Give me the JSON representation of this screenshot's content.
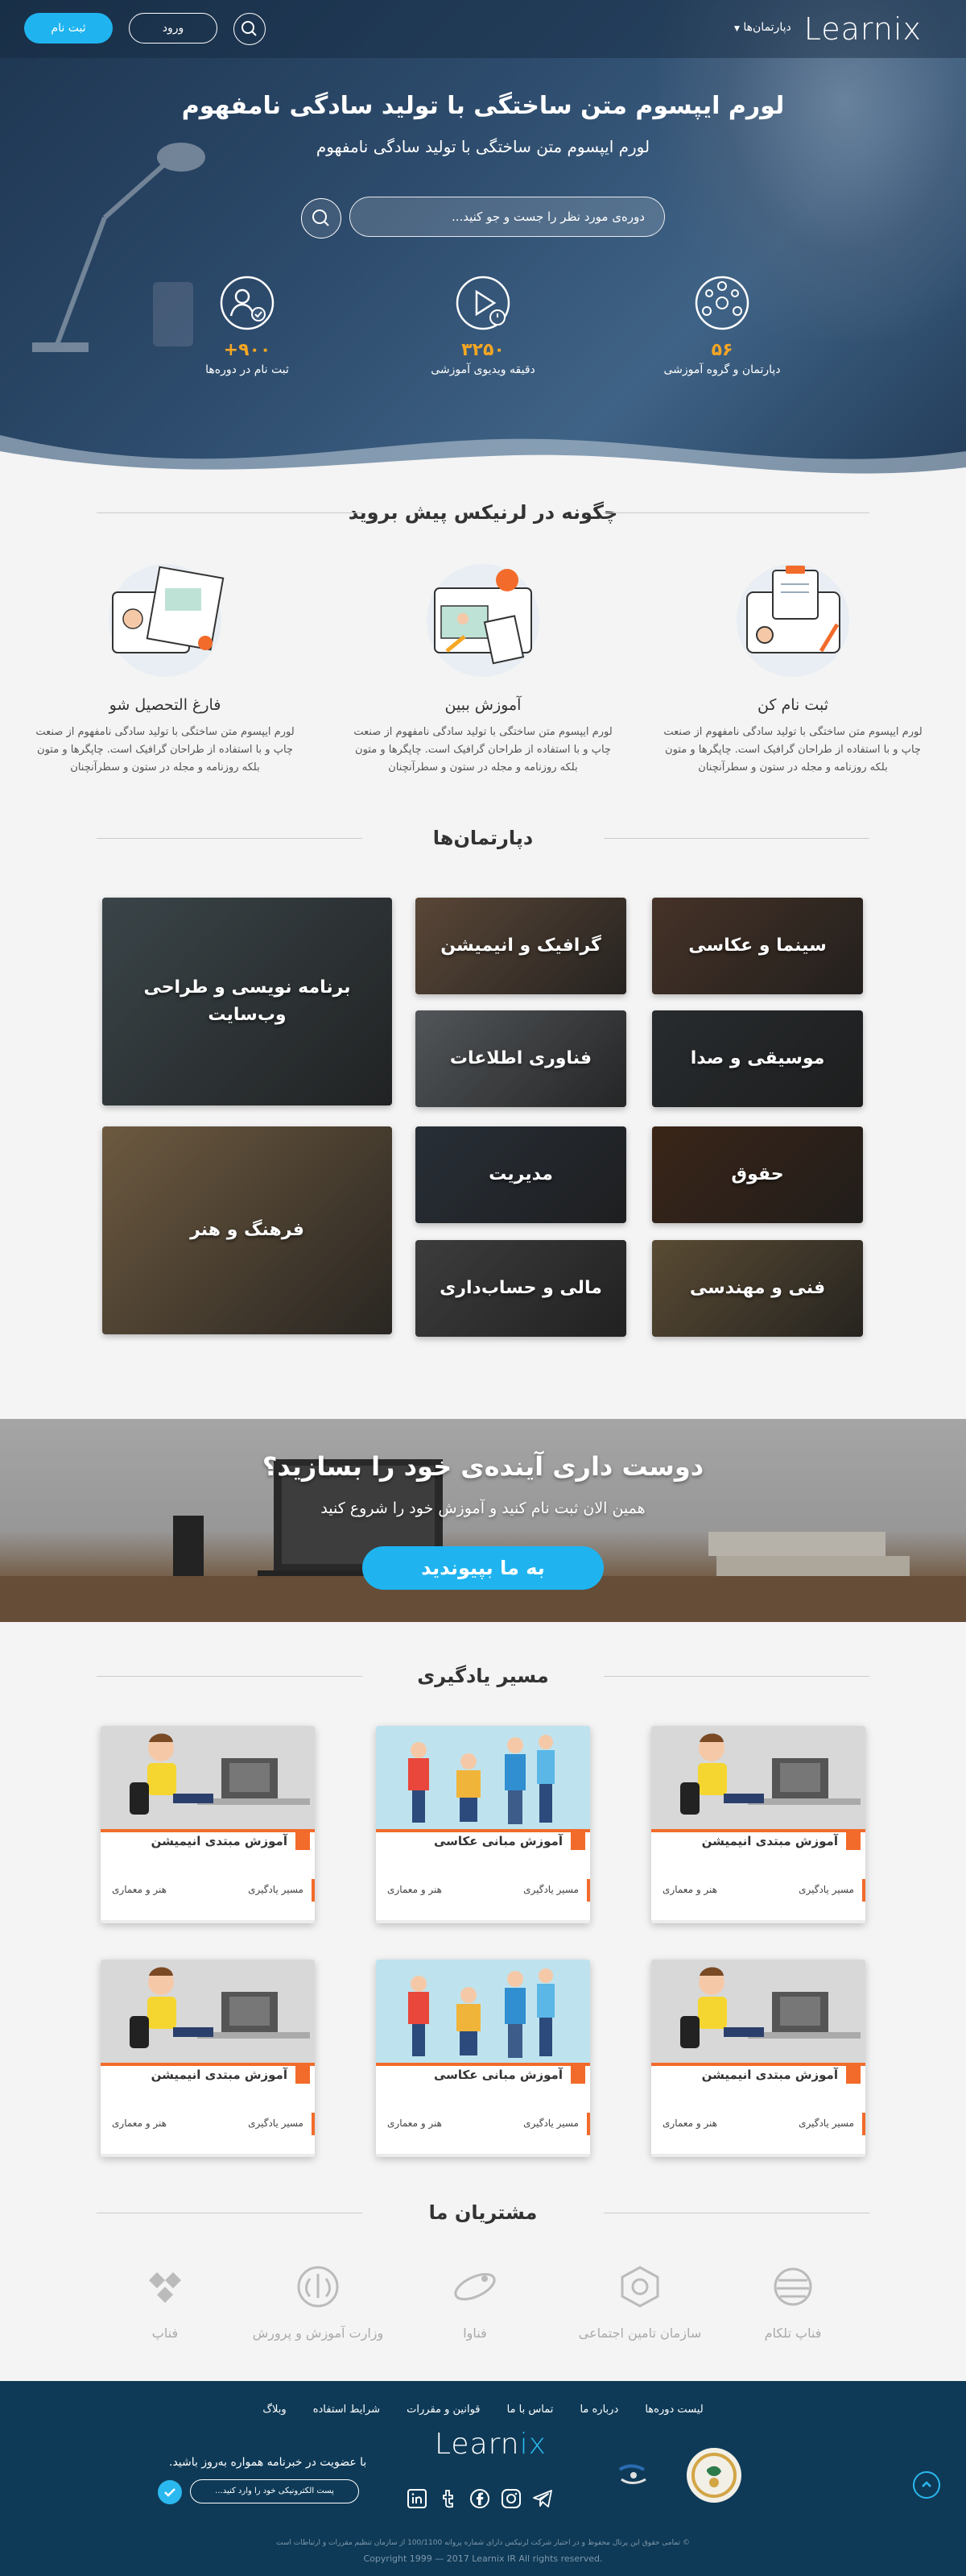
{
  "header": {
    "logo": "Learnix",
    "departments_menu": "دپارتمان‌ها",
    "login": "ورود",
    "signup": "ثبت نام"
  },
  "hero": {
    "title": "لورم ایپسوم متن ساختگی با تولید سادگی نامفهوم",
    "subtitle": "لورم ایپسوم متن ساختگی با تولید سادگی نامفهوم",
    "search_placeholder": "دوره‌ی مورد نظر را جست و جو کنید...",
    "stats": [
      {
        "icon": "group-network-icon",
        "number": "۵۶",
        "label": "دپارتمان و گروه آموزشی"
      },
      {
        "icon": "video-clock-icon",
        "number": "۳۲۵۰",
        "label": "دقیقه ویدیوی آموزشی"
      },
      {
        "icon": "users-check-icon",
        "number": "+۹۰۰",
        "label": "ثبت نام در دوره‌ها"
      }
    ]
  },
  "how": {
    "heading": "چگونه در لرنیکس پیش بروید",
    "steps": [
      {
        "title": "ثبت نام کن",
        "desc": "لورم ایپسوم متن ساختگی با تولید سادگی نامفهوم از صنعت چاپ و با استفاده از طراحان گرافیک است. چاپگرها و متون بلکه روزنامه و مجله در ستون و سطرآنچنان"
      },
      {
        "title": "آموزش ببین",
        "desc": "لورم ایپسوم متن ساختگی با تولید سادگی نامفهوم از صنعت چاپ و با استفاده از طراحان گرافیک است. چاپگرها و متون بلکه روزنامه و مجله در ستون و سطرآنچنان"
      },
      {
        "title": "فارغ التحصیل شو",
        "desc": "لورم ایپسوم متن ساختگی با تولید سادگی نامفهوم از صنعت چاپ و با استفاده از طراحان گرافیک است. چاپگرها و متون بلکه روزنامه و مجله در ستون و سطرآنچنان"
      }
    ]
  },
  "departments": {
    "heading": "دپارتمان‌ها",
    "items": [
      {
        "label": "سینما و عکاسی",
        "color": "#6b4e3d"
      },
      {
        "label": "گرافیک و انیمیشن",
        "color": "#8a6d55"
      },
      {
        "label": "برنامه نویسی و طراحی وب‌سایت",
        "color": "#5a6a70"
      },
      {
        "label": "موسیقی و صدا",
        "color": "#3d4347"
      },
      {
        "label": "فناوری اطلاعات",
        "color": "#7e8489"
      },
      {
        "label": "حقوق",
        "color": "#5a3a26"
      },
      {
        "label": "مدیریت",
        "color": "#3e4855"
      },
      {
        "label": "فرهنگ و هنر",
        "color": "#a88a63"
      },
      {
        "label": "فنی و مهندسی",
        "color": "#8a7450"
      },
      {
        "label": "مالی و حساب‌داری",
        "color": "#5d5d5d"
      }
    ]
  },
  "join": {
    "title": "دوست داری آینده‌ی خود را بسازید؟",
    "subtitle": "همین الان ثبت نام کنید و آموزش خود را شروع کنید",
    "button": "به ما بپیوندید"
  },
  "learning_path": {
    "heading": "مسیر یادگیری",
    "cards": [
      {
        "title": "آموزش مبتدی انیمیشن",
        "path": "مسیر یادگیری",
        "category": "هنر و معماری",
        "image": "animator-desk"
      },
      {
        "title": "آموزش مبانی عکاسی",
        "path": "مسیر یادگیری",
        "category": "هنر و معماری",
        "image": "photographers"
      },
      {
        "title": "آموزش مبتدی انیمیشن",
        "path": "مسیر یادگیری",
        "category": "هنر و معماری",
        "image": "animator-desk"
      },
      {
        "title": "آموزش مبتدی انیمیشن",
        "path": "مسیر یادگیری",
        "category": "هنر و معماری",
        "image": "animator-desk"
      },
      {
        "title": "آموزش مبانی عکاسی",
        "path": "مسیر یادگیری",
        "category": "هنر و معماری",
        "image": "photographers"
      },
      {
        "title": "آموزش مبتدی انیمیشن",
        "path": "مسیر یادگیری",
        "category": "هنر و معماری",
        "image": "animator-desk"
      }
    ]
  },
  "clients": {
    "heading": "مشتریان ما",
    "items": [
      {
        "name": "فناپ تلکام",
        "icon": "sphere-icon"
      },
      {
        "name": "سازمان تامین اجتماعی",
        "icon": "emblem-icon"
      },
      {
        "name": "فناوا",
        "icon": "orbit-icon"
      },
      {
        "name": "وزارت آموزش و پرورش",
        "icon": "iran-emblem-icon"
      },
      {
        "name": "فناپ",
        "icon": "fanap-icon"
      }
    ]
  },
  "footer": {
    "nav": [
      "لیست دوره‌ها",
      "درباره ما",
      "تماس با ما",
      "قوانین و مقررات",
      "شرایط استفاده",
      "وبلاگ"
    ],
    "logo_main": "Learn",
    "logo_accent": "ix",
    "newsletter_text": "با عضویت در خبرنامه همواره به‌روز باشید.",
    "newsletter_placeholder": "پست الکترونیکی خود را وارد کنید...",
    "copyright_fa": "© تمامی حقوق این پرتال محفوظ و در اختیار شرکت لرنیکس دارای شماره پروانه 100/1100 از سازمان تنظیم مقررات و ارتباطات است",
    "copyright_en": "Copyright 1999 — 2017 Learnix IR All rights reserved."
  },
  "colors": {
    "accent": "#1fb4f0",
    "orange": "#f26b2b",
    "footer": "#0e3a57",
    "stat_number": "#f5a623"
  }
}
